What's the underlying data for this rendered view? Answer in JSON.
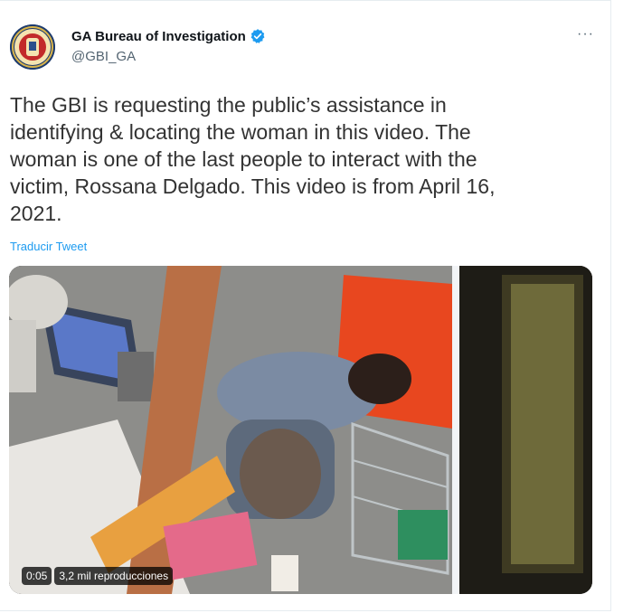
{
  "tweet": {
    "author_name": "GA Bureau of Investigation",
    "handle": "@GBI_GA",
    "more_label": "···",
    "text": "The GBI is requesting the public’s assistance in\nidentifying & locating the woman in this video.  The\nwoman is one of the last people to interact with the\nvictim, Rossana Delgado.  This video is from April 16,\n2021.",
    "translate_label": "Traducir Tweet"
  },
  "video": {
    "time": "0:05",
    "views": "3,2 mil reproducciones"
  },
  "colors": {
    "link": "#1d9bf0",
    "verified": "#1d9bf0",
    "avatar_bg": "#1d3b6e"
  }
}
